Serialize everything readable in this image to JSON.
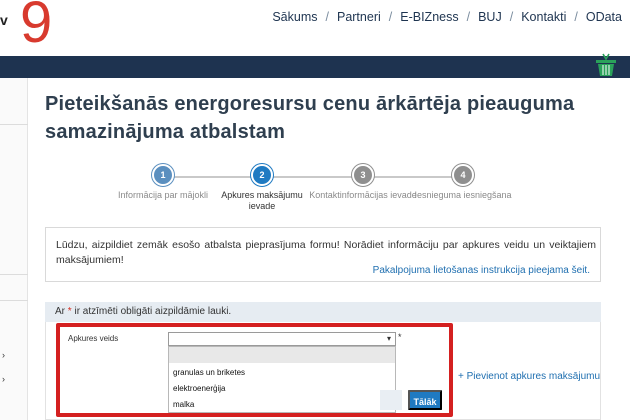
{
  "header": {
    "brand_left": "v",
    "brand_number": "9",
    "nav": [
      {
        "label": "Sākums"
      },
      {
        "label": "Partneri"
      },
      {
        "label": "E-BIZness"
      },
      {
        "label": "BUJ"
      },
      {
        "label": "Kontakti"
      },
      {
        "label": "OData"
      }
    ],
    "separator": "/"
  },
  "page": {
    "title": "Pieteikšanās energoresursu cenu ārkārtēja pieauguma samazinājuma atbalstam"
  },
  "stepper": {
    "steps": [
      {
        "number": "1",
        "label": "Informācija par mājokli",
        "state": "done"
      },
      {
        "number": "2",
        "label": "Apkures maksājumu ievade",
        "state": "active"
      },
      {
        "number": "3",
        "label": "Kontaktinformācijas ievade",
        "state": "todo"
      },
      {
        "number": "4",
        "label": "Iesnieguma iesniegšana",
        "state": "todo"
      }
    ]
  },
  "info": {
    "text": "Lūdzu, aizpildiet zemāk esošo atbalsta pieprasījuma formu! Norādiet informāciju par apkures veidu un veiktajiem maksājumiem!",
    "link": "Pakalpojuma lietošanas instrukcija pieejama šeit."
  },
  "required_note": {
    "prefix": "Ar",
    "star": "*",
    "suffix": "ir atzīmēti obligāti aizpildāmie lauki."
  },
  "form": {
    "field_label": "Apkures veids",
    "selected_value": "",
    "required_mark": "*",
    "dropdown_options": [
      "",
      "granulas un briketes",
      "elektroenerģija",
      "malka"
    ],
    "add_link": "+ Pievienot apkures maksājumu",
    "next_button": "Tālāk"
  },
  "colors": {
    "accent": "#1f7ac2",
    "brand_red": "#d83a2e",
    "nav_band": "#1e3350",
    "highlight": "#d42020"
  },
  "icons": {
    "cart": "shopping-basket-icon",
    "select_arrow": "chevron-down-icon"
  }
}
